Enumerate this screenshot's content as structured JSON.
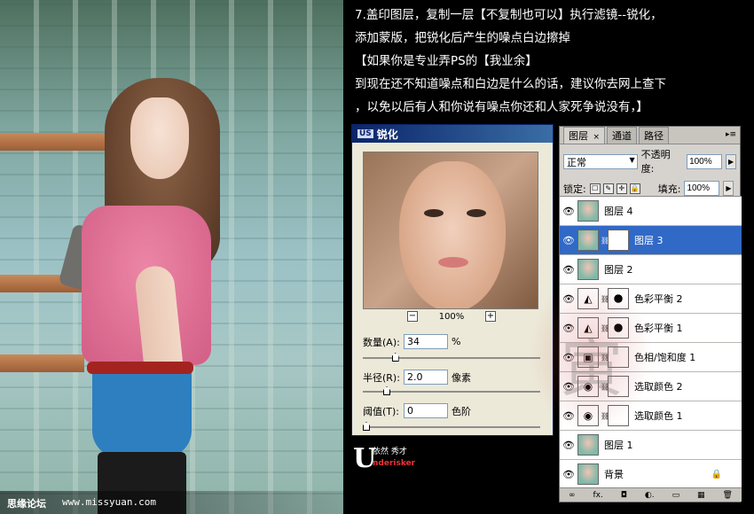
{
  "photo_watermark": {
    "site_name": "思缘论坛",
    "site_url": "www.missyuan.com"
  },
  "instructions": {
    "lines": [
      "7.盖印图层，复制一层【不复制也可以】执行滤镜--锐化，",
      "添加蒙版，把锐化后产生的噪点白边擦掉",
      "【如果你是专业弄PS的【我业余】",
      "到现在还不知道噪点和白边是什么的话，建议你去网上查下",
      "，以免以后有人和你说有噪点你还和人家死争说没有，】"
    ]
  },
  "sharpen_dialog": {
    "title_icon": "US",
    "title": "锐化",
    "zoom_out_label": "−",
    "zoom_level": "100%",
    "zoom_in_label": "+",
    "amount_label": "数量(A):",
    "amount_value": "34",
    "amount_unit": "%",
    "amount_slider_fraction": 0.17,
    "radius_label": "半径(R):",
    "radius_value": "2.0",
    "radius_unit": "像素",
    "radius_slider_fraction": 0.12,
    "threshold_label": "阈值(T):",
    "threshold_value": "0",
    "threshold_unit": "色阶",
    "threshold_slider_fraction": 0.0
  },
  "brand": {
    "letter": "U",
    "line1": "依然 秀才",
    "line2": "nderisker"
  },
  "layers_panel": {
    "tabs": [
      {
        "label": "图层",
        "close": "×"
      },
      {
        "label": "通道"
      },
      {
        "label": "路径"
      }
    ],
    "menu_icon": "▸≡",
    "blend_mode": "正常",
    "opacity_label": "不透明度:",
    "opacity_value": "100%",
    "lock_label": "锁定:",
    "lock_icons": [
      "☐",
      "✎",
      "✛",
      "🔒"
    ],
    "fill_label": "填充:",
    "fill_value": "100%",
    "layers": [
      {
        "name": "图层 4",
        "type": "photo",
        "selected": false
      },
      {
        "name": "图层 3",
        "type": "photo-mask",
        "selected": true
      },
      {
        "name": "图层 2",
        "type": "photo",
        "selected": false
      },
      {
        "name": "色彩平衡 2",
        "type": "adjust",
        "adjust_icon": "◭",
        "selected": false
      },
      {
        "name": "色彩平衡 1",
        "type": "adjust",
        "adjust_icon": "◭",
        "selected": false
      },
      {
        "name": "色相/饱和度 1",
        "type": "adjust",
        "adjust_icon": "▣",
        "selected": false
      },
      {
        "name": "选取颜色 2",
        "type": "adjust",
        "adjust_icon": "◉",
        "selected": false
      },
      {
        "name": "选取颜色 1",
        "type": "adjust",
        "adjust_icon": "◉",
        "selected": false
      },
      {
        "name": "图层 1",
        "type": "photo",
        "selected": false
      },
      {
        "name": "背景",
        "type": "photo",
        "locked": true,
        "selected": false
      }
    ],
    "footer_icons": [
      "∞",
      "fx.",
      "◘",
      "◐.",
      "▭",
      "▦",
      "🗑"
    ]
  },
  "colors": {
    "selected_layer": "#3169c6",
    "dialog_title": "#0a246a",
    "panel_bg": "#d6d3ce"
  }
}
